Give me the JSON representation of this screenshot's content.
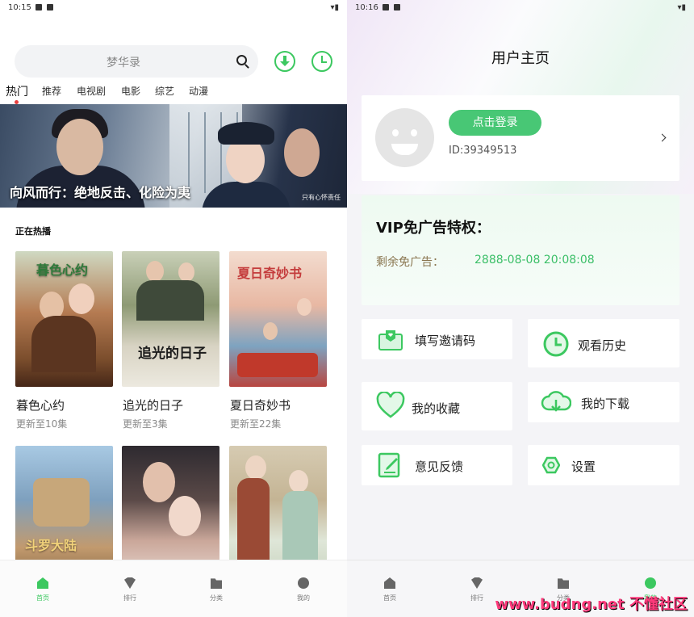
{
  "left": {
    "status_time": "10:15",
    "search_placeholder": "梦华录",
    "tabs": [
      "热门",
      "推荐",
      "电视剧",
      "电影",
      "综艺",
      "动漫"
    ],
    "banner_title": "向风而行：绝地反击、化险为夷",
    "banner_small": "只有心怀责任",
    "section_title": "正在热播",
    "cards": [
      {
        "title": "暮色心约",
        "update": "更新至10集",
        "poster_text": "暮色心约"
      },
      {
        "title": "追光的日子",
        "update": "更新至3集",
        "poster_text": "追光的日子"
      },
      {
        "title": "夏日奇妙书",
        "update": "更新至22集",
        "poster_text": "夏日奇妙书"
      },
      {
        "title": "",
        "update": "",
        "poster_text": "斗罗大陆"
      },
      {
        "title": "",
        "update": "",
        "poster_text": ""
      },
      {
        "title": "",
        "update": "",
        "poster_text": ""
      }
    ],
    "nav": [
      "首页",
      "排行",
      "分类",
      "我的"
    ]
  },
  "right": {
    "status_time": "10:16",
    "page_title": "用户主页",
    "login_button": "点击登录",
    "user_id": "ID:39349513",
    "vip_title": "VIP免广告特权：",
    "vip_label": "剩余免广告：",
    "vip_value": "2888-08-08 20:08:08",
    "menu": [
      "填写邀请码",
      "观看历史",
      "我的收藏",
      "我的下载",
      "意见反馈",
      "设置"
    ],
    "nav": [
      "首页",
      "排行",
      "分类",
      "我的"
    ],
    "watermark": "www.budng.net 不懂社区"
  },
  "colors": {
    "accent": "#3cc860",
    "vip_value": "#3bbf68"
  }
}
